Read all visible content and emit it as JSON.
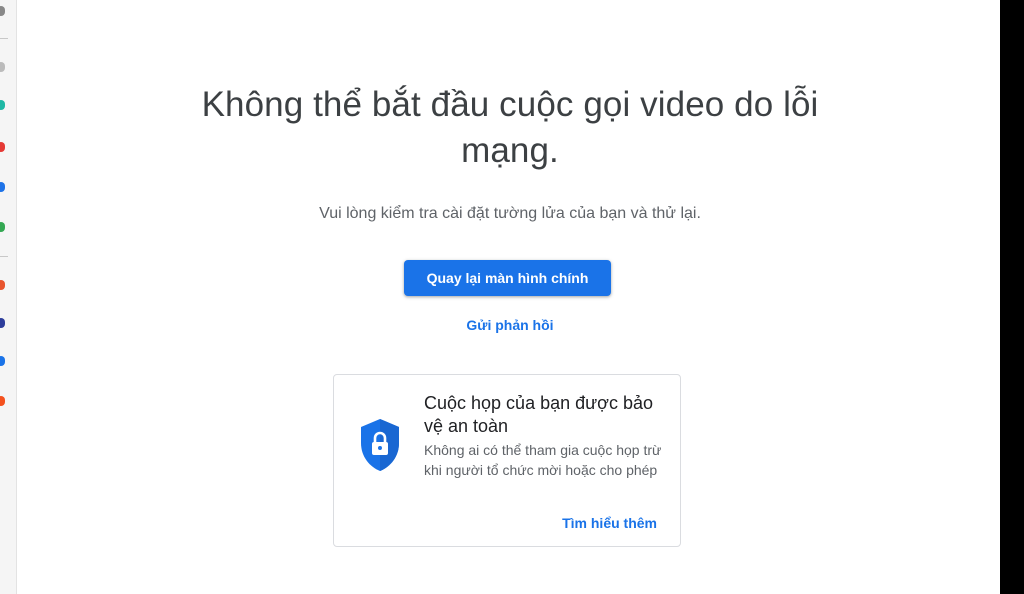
{
  "main": {
    "heading": "Không thể bắt đầu cuộc gọi video do lỗi mạng.",
    "subtext": "Vui lòng kiểm tra cài đặt tường lửa của bạn và thử lại.",
    "primary_button": "Quay lại màn hình chính",
    "feedback_link": "Gửi phản hồi"
  },
  "security_card": {
    "title": "Cuộc họp của bạn được bảo vệ an toàn",
    "description": "Không ai có thể tham gia cuộc họp trừ khi người tổ chức mời hoặc cho phép",
    "learn_more": "Tìm hiểu thêm",
    "icon": "shield-lock-icon"
  },
  "colors": {
    "accent": "#1a73e8",
    "heading": "#3c4043",
    "muted": "#5f6368"
  }
}
